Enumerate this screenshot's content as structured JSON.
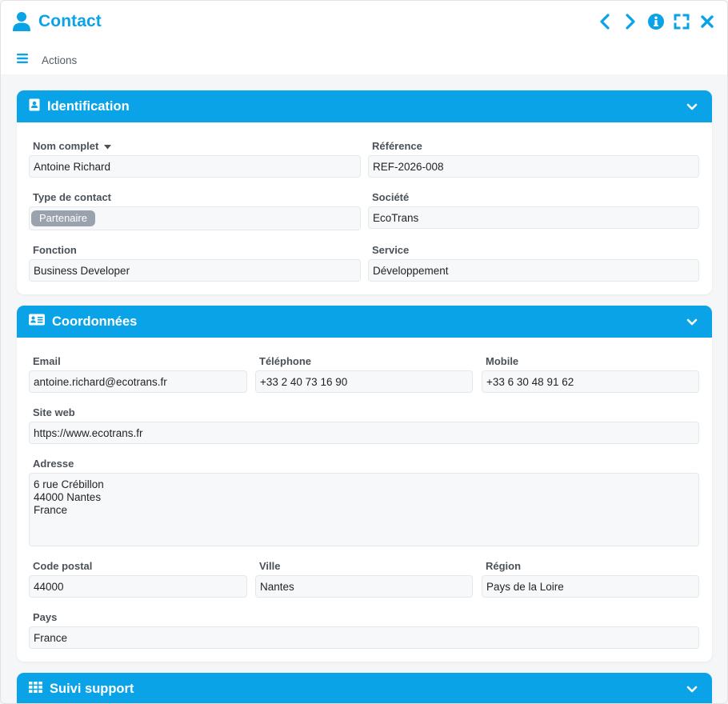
{
  "header": {
    "title": "Contact",
    "actions_label": "Actions",
    "icons": [
      "user-icon",
      "chevron-left-icon",
      "chevron-right-icon",
      "info-icon",
      "expand-icon",
      "close-icon",
      "menu-icon"
    ]
  },
  "colors": {
    "accent": "#0aa3e8",
    "badge": "#9aa3ad"
  },
  "identification": {
    "title": "Identification",
    "nom_label": "Nom complet",
    "nom_value": "Antoine Richard",
    "reference_label": "Référence",
    "reference_value": "REF-2026-008",
    "type_label": "Type de contact",
    "type_value": "Partenaire",
    "societe_label": "Société",
    "societe_value": "EcoTrans",
    "fonction_label": "Fonction",
    "fonction_value": "Business Developer",
    "service_label": "Service",
    "service_value": "Développement"
  },
  "coordonnees": {
    "title": "Coordonnées",
    "email_label": "Email",
    "email_value": "antoine.richard@ecotrans.fr",
    "telephone_label": "Téléphone",
    "telephone_value": "+33 2 40 73 16 90",
    "mobile_label": "Mobile",
    "mobile_value": "+33 6 30 48 91 62",
    "site_label": "Site web",
    "site_value": "https://www.ecotrans.fr",
    "adresse_label": "Adresse",
    "adresse_value": "6 rue Crébillon\n44000 Nantes\nFrance",
    "cp_label": "Code postal",
    "cp_value": "44000",
    "ville_label": "Ville",
    "ville_value": "Nantes",
    "region_label": "Région",
    "region_value": "Pays de la Loire",
    "pays_label": "Pays",
    "pays_value": "France"
  },
  "suivi": {
    "title": "Suivi support"
  }
}
